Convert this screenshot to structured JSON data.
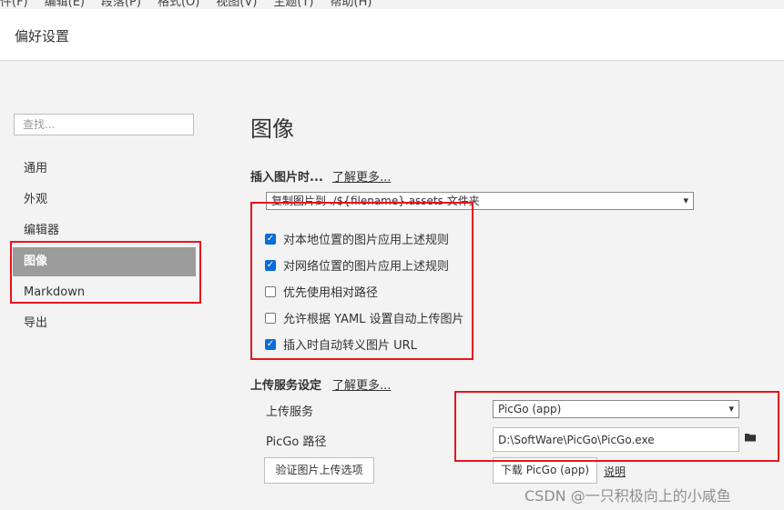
{
  "menubar": [
    "件(F)",
    "编辑(E)",
    "段落(P)",
    "格式(O)",
    "视图(V)",
    "主题(T)",
    "帮助(H)"
  ],
  "window": {
    "title": "偏好设置"
  },
  "sidebar": {
    "search_placeholder": "查找...",
    "items": [
      {
        "label": "通用"
      },
      {
        "label": "外观"
      },
      {
        "label": "编辑器"
      },
      {
        "label": "图像",
        "active": true
      },
      {
        "label": "Markdown"
      },
      {
        "label": "导出"
      }
    ]
  },
  "main": {
    "title": "图像",
    "insert": {
      "label": "插入图片时...",
      "learn_more": "了解更多...",
      "action_value": "复制图片到 ./${filename}.assets 文件夹",
      "options": [
        {
          "label": "对本地位置的图片应用上述规则",
          "checked": true
        },
        {
          "label": "对网络位置的图片应用上述规则",
          "checked": true
        },
        {
          "label": "优先使用相对路径",
          "checked": false
        },
        {
          "label": "允许根据 YAML 设置自动上传图片",
          "checked": false
        },
        {
          "label": "插入时自动转义图片 URL",
          "checked": true
        }
      ]
    },
    "upload": {
      "label": "上传服务设定",
      "learn_more": "了解更多...",
      "service_label": "上传服务",
      "service_value": "PicGo (app)",
      "path_label": "PicGo 路径",
      "path_value": "D:\\SoftWare\\PicGo\\PicGo.exe",
      "verify_button": "验证图片上传选项",
      "download_button": "下载 PicGo (app)",
      "help_link": "说明"
    }
  },
  "watermark": "CSDN @一只积极向上的小咸鱼",
  "colors": {
    "highlight_box": "#e8141e",
    "active_nav": "#9b9b9b",
    "checkbox_checked": "#0b6cd6"
  }
}
